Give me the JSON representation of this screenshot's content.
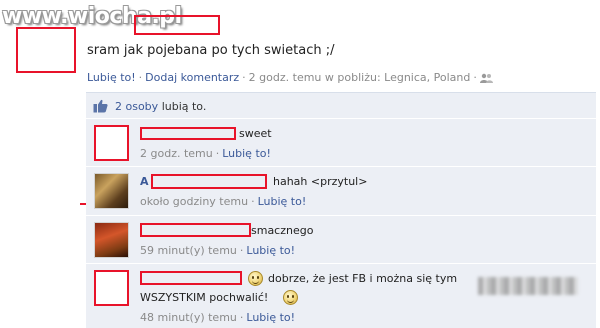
{
  "watermark": "www.wiocha.pl",
  "post": {
    "text": "sram jak pojebana po tych swietach ;/",
    "like_link": "Lubię to!",
    "comment_link": "Dodaj komentarz",
    "time_location": "2 godz. temu w pobliżu: Legnica, Poland",
    "audience_icon": "friends-icon"
  },
  "likes": {
    "count_text": "2 osoby",
    "suffix": "lubią to.",
    "icon": "thumbs-up-icon"
  },
  "comments": [
    {
      "text": "sweet",
      "time": "2 godz. temu",
      "like": "Lubię to!"
    },
    {
      "name_initial": "A",
      "text": "hahah <przytul>",
      "time": "około godziny temu",
      "like": "Lubię to!"
    },
    {
      "text": "smacznego",
      "time": "59 minut(y) temu",
      "like": "Lubię to!"
    },
    {
      "text_line1": "dobrze, że jest FB i można się tym",
      "text_line2": "WSZYSTKIM pochwalić!",
      "time": "48 minut(y) temu",
      "like": "Lubię to!"
    }
  ],
  "colors": {
    "link": "#3b5998",
    "censor_red": "#e8132a",
    "comment_bg": "#eceff5",
    "meta_gray": "#8a8a8a"
  }
}
